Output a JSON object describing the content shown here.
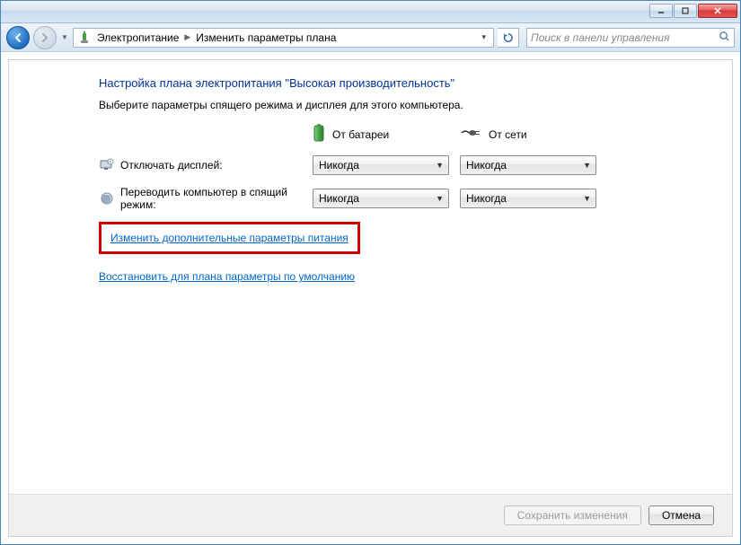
{
  "titlebar": {},
  "nav": {
    "breadcrumb": [
      "Электропитание",
      "Изменить параметры плана"
    ],
    "search_placeholder": "Поиск в панели управления"
  },
  "page": {
    "title": "Настройка плана электропитания \"Высокая производительность\"",
    "subtitle": "Выберите параметры спящего режима и дисплея для этого компьютера."
  },
  "columns": {
    "battery": "От батареи",
    "ac": "От сети"
  },
  "settings": [
    {
      "label": "Отключать дисплей:",
      "battery_value": "Никогда",
      "ac_value": "Никогда",
      "icon": "display"
    },
    {
      "label": "Переводить компьютер в спящий режим:",
      "battery_value": "Никогда",
      "ac_value": "Никогда",
      "icon": "sleep"
    }
  ],
  "links": {
    "advanced": "Изменить дополнительные параметры питания",
    "restore": "Восстановить для плана параметры по умолчанию"
  },
  "buttons": {
    "save": "Сохранить изменения",
    "cancel": "Отмена"
  }
}
